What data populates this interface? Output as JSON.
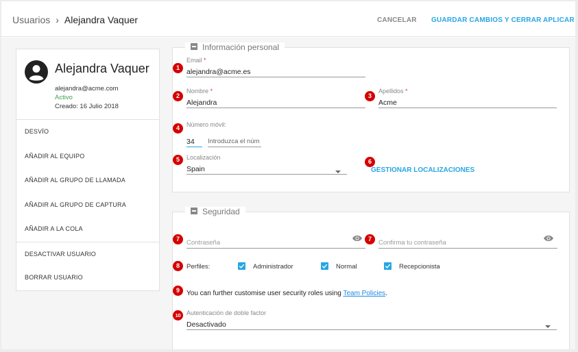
{
  "header": {
    "breadcrumb_root": "Usuarios",
    "breadcrumb_separator": "›",
    "breadcrumb_current": "Alejandra Vaquer",
    "cancel_label": "CANCELAR",
    "save_close_label": "GUARDAR CAMBIOS Y CERRAR",
    "apply_label": "APLICAR"
  },
  "user": {
    "name": "Alejandra Vaquer",
    "email": "alejandra@acme.com",
    "status": "Activo",
    "created": "Creado: 16 Julio 2018"
  },
  "menu": {
    "items": [
      "DESVÍO",
      "AÑADIR AL EQUIPO",
      "AÑADIR AL GRUPO DE LLAMADA",
      "AÑADIR AL GRUPO DE CAPTURA",
      "AÑADIR A LA COLA"
    ],
    "danger_items": [
      "DESACTIVAR USUARIO",
      "BORRAR USUARIO"
    ]
  },
  "personal": {
    "title": "Información personal",
    "email_label": "Email",
    "email_value": "alejandra@acme.es",
    "nombre_label": "Nombre",
    "nombre_value": "Alejandra",
    "apellidos_label": "Apellidos",
    "apellidos_value": "Acme",
    "movil_label": "Número móvil:",
    "movil_prefix": "34",
    "movil_placeholder": "Introduzca el núm",
    "localizacion_label": "Localización",
    "localizacion_value": "Spain",
    "gestionar_label": "GESTIONAR LOCALIZACIONES",
    "required_mark": "*"
  },
  "security": {
    "title": "Seguridad",
    "password_placeholder": "Contraseña",
    "confirm_placeholder": "Confirma tu contraseña",
    "perfiles_label": "Perfiles:",
    "profiles": [
      "Administrador",
      "Normal",
      "Recepcionista"
    ],
    "roles_text": "You can further customise user security roles using ",
    "roles_link": "Team Policies",
    "roles_end": ".",
    "twofactor_label": "Autenticación de doble factor",
    "twofactor_value": "Desactivado"
  },
  "badges": [
    "1",
    "2",
    "3",
    "4",
    "5",
    "6",
    "7",
    "7",
    "8",
    "9",
    "10"
  ],
  "colors": {
    "accent": "#27a6e4",
    "badge": "#d50000",
    "status_active": "#43a047",
    "required": "#e53935"
  },
  "icons": {
    "avatar": "account-circle-icon",
    "eye": "eye-icon",
    "dropdown": "caret-down-icon",
    "collapse": "minus-square-icon",
    "checkbox": "check-icon"
  }
}
